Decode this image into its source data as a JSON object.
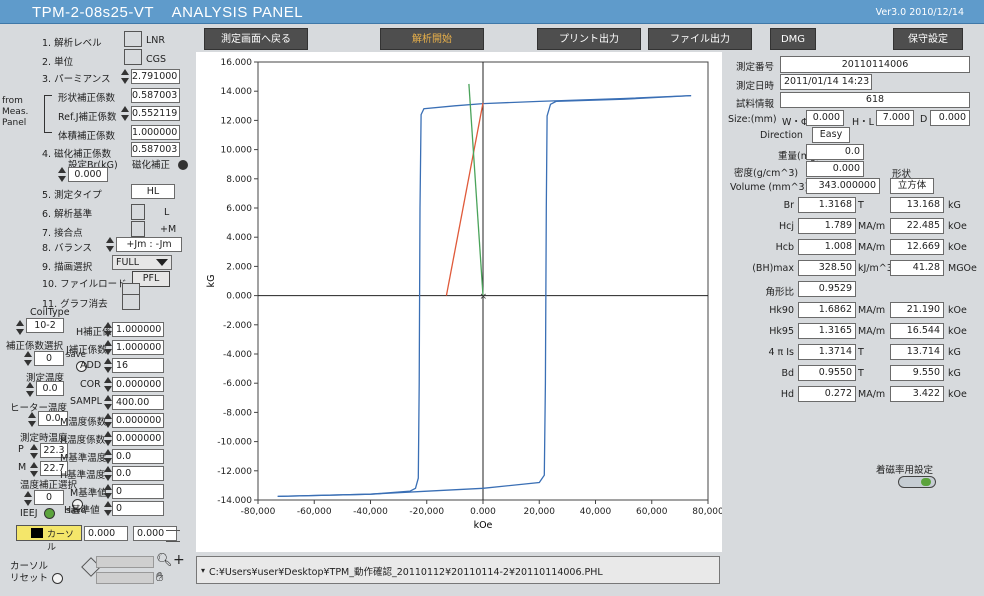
{
  "window": {
    "title": "TPM-2-08s25-VT    ANALYSIS PANEL",
    "version": "Ver3.0 2010/12/14"
  },
  "toolbar": {
    "back": "測定画面へ戻る",
    "analyze": "解析開始",
    "print": "プリント出力",
    "file": "ファイル出力",
    "dmg": "DMG",
    "maint": "保守設定"
  },
  "left": {
    "r1": "1. 解析レベル",
    "r1_opt": "LNR",
    "r2": "2. 単位",
    "r2_opt": "CGS",
    "r3": "3. パーミアンス",
    "r3_val": "2.791000",
    "shape": "形状補正係数",
    "shape_val": "0.587003",
    "refj": "Ref.J補正係数",
    "refj_val": "0.552119",
    "vol": "体積補正係数",
    "vol_val": "1.000000",
    "from": "from Meas. Panel",
    "r4": "4. 磁化補正係数",
    "r4_val": "0.587003",
    "br_set": "設定Br(kG)",
    "br_set_val": "0.000",
    "mag_corr": "磁化補正",
    "r5": "5. 測定タイプ",
    "r5_val": "HL",
    "r6": "6. 解析基準",
    "r6_val": "L",
    "r7": "7. 接合点",
    "r7_val": "+M",
    "r8": "8. バランス",
    "r8_val": "+Jm : -Jm",
    "r9": "9. 描画選択",
    "r9_val": "FULL",
    "r10": "10. ファイルロード",
    "r10_val": "PFL",
    "r11": "11. グラフ消去",
    "coil": "CoilType",
    "coil_val": "10-2",
    "corr_sel": "補正係数選択",
    "corr_sel_val": "0",
    "save": "save",
    "temp": "測定温度",
    "temp_val": "0.0",
    "heater": "ヒーター温度",
    "heater_val": "0.0",
    "meas_temp": "測定時温度",
    "p_lbl": "P",
    "p_val": "22.3",
    "m_lbl": "M",
    "m_val": "22.7",
    "temp_sel": "温度補正選択",
    "temp_sel_val": "0",
    "ieej": "IEEJ",
    "h_corr": "H補正係数",
    "h_corr_val": "1.000000",
    "j_corr": "J補正係数",
    "j_corr_val": "1.000000",
    "add": "ADD",
    "add_val": "16",
    "cor": "COR",
    "cor_val": "0.000000",
    "sampl": "SAMPL",
    "sampl_val": "400.00",
    "m_temp_coef": "M温度係数",
    "m_temp_coef_val": "0.000000",
    "h_temp_coef": "H温度係数",
    "h_temp_coef_val": "0.000000",
    "m_ref_temp": "M基準温度",
    "m_ref_temp_val": "0.0",
    "h_ref_temp": "H基準温度",
    "h_ref_temp_val": "0.0",
    "m_ref_val": "M基準値",
    "m_ref_val_val": "0",
    "h_ref_val": "H基準値",
    "h_ref_val_val": "0",
    "cursor_lbl": "カーソル",
    "cursor_x": "0.000",
    "cursor_y": "0.000",
    "cursor_reset": "カーソル リセット"
  },
  "path": "C:¥Users¥user¥Desktop¥TPM_動作確認_20110112¥20110114-2¥20110114006.PHL",
  "right": {
    "meas_no": "測定番号",
    "meas_no_val": "20110114006",
    "meas_dt": "測定日時",
    "meas_dt_val": "2011/01/14 14:23",
    "sample": "試料情報",
    "sample_val": "618",
    "size": "Size:(mm)",
    "w": "W・Φ",
    "w_val": "0.000",
    "h": "H・L",
    "h_val": "7.000",
    "d": "D",
    "d_val": "0.000",
    "direction": "Direction",
    "direction_val": "Easy",
    "weight": "重量(mg)",
    "weight_val": "0.0",
    "density": "密度(g/cm^3)",
    "density_val": "0.000",
    "shape": "形状",
    "volume": "Volume (mm^3)",
    "volume_val": "343.000000",
    "shape_val": "立方体",
    "rows": [
      {
        "name": "Br",
        "si": "1.3168",
        "siu": "T",
        "cgs": "13.168",
        "cgsu": "kG"
      },
      {
        "name": "Hcj",
        "si": "1.789",
        "siu": "MA/m",
        "cgs": "22.485",
        "cgsu": "kOe"
      },
      {
        "name": "Hcb",
        "si": "1.008",
        "siu": "MA/m",
        "cgs": "12.669",
        "cgsu": "kOe"
      },
      {
        "name": "(BH)max",
        "si": "328.50",
        "siu": "kJ/m^3",
        "cgs": "41.28",
        "cgsu": "MGOe"
      },
      {
        "name": "角形比",
        "si": "0.9529",
        "siu": "",
        "cgs": "",
        "cgsu": ""
      },
      {
        "name": "Hk90",
        "si": "1.6862",
        "siu": "MA/m",
        "cgs": "21.190",
        "cgsu": "kOe"
      },
      {
        "name": "Hk95",
        "si": "1.3165",
        "siu": "MA/m",
        "cgs": "16.544",
        "cgsu": "kOe"
      },
      {
        "name": "4 π Is",
        "si": "1.3714",
        "siu": "T",
        "cgs": "13.714",
        "cgsu": "kG"
      },
      {
        "name": "Bd",
        "si": "0.9550",
        "siu": "T",
        "cgs": "9.550",
        "cgsu": "kG"
      },
      {
        "name": "Hd",
        "si": "0.272",
        "siu": "MA/m",
        "cgs": "3.422",
        "cgsu": "kOe"
      }
    ],
    "mag_setting": "着磁率用設定"
  },
  "colors": {
    "title_bar": "#5f9bcb",
    "button_dark": "#4e4e4e",
    "analyze_text": "#e8b04a",
    "loop": "#3a6fb5",
    "red_line": "#e05a3a",
    "green_line": "#4aa35a",
    "radio_on": "#5ba33c"
  },
  "chart_data": {
    "type": "line",
    "xlabel": "kOe",
    "ylabel": "kG",
    "xlim": [
      -80000,
      80000
    ],
    "ylim": [
      -14,
      16
    ],
    "xticks": [
      "-80,000",
      "-60,000",
      "-40,000",
      "-20,000",
      "0.000",
      "20,000",
      "40,000",
      "60,000",
      "80,000"
    ],
    "yticks": [
      "16.000",
      "14.000",
      "12.000",
      "10.000",
      "8.000",
      "6.000",
      "4.000",
      "2.000",
      "0.000",
      "-2.000",
      "-4.000",
      "-6.000",
      "-8.000",
      "-10.000",
      "-12.000",
      "-14.000"
    ],
    "series": [
      {
        "color": "#3a6fb5",
        "points": [
          [
            -73000,
            -13.75
          ],
          [
            -40000,
            -13.6
          ],
          [
            -26000,
            -13.4
          ],
          [
            -24000,
            -13.2
          ],
          [
            -23000,
            -12.5
          ],
          [
            -22700,
            -6
          ],
          [
            -22400,
            6
          ],
          [
            -22000,
            12.4
          ],
          [
            -21000,
            12.8
          ],
          [
            -10000,
            13.0
          ],
          [
            0,
            13.15
          ],
          [
            20000,
            13.3
          ],
          [
            50000,
            13.5
          ],
          [
            74000,
            13.7
          ]
        ]
      },
      {
        "color": "#3a6fb5",
        "points": [
          [
            74000,
            13.7
          ],
          [
            50000,
            13.45
          ],
          [
            26000,
            13.3
          ],
          [
            24000,
            13.1
          ],
          [
            22800,
            12.3
          ],
          [
            22500,
            6
          ],
          [
            22200,
            -6
          ],
          [
            21800,
            -12.3
          ],
          [
            20000,
            -12.8
          ],
          [
            0,
            -13.2
          ],
          [
            -20000,
            -13.4
          ],
          [
            -40000,
            -13.6
          ],
          [
            -73000,
            -13.75
          ]
        ]
      },
      {
        "color": "#e05a3a",
        "points": [
          [
            -13000,
            0
          ],
          [
            0,
            13.2
          ]
        ]
      },
      {
        "color": "#4aa35a",
        "points": [
          [
            -5000,
            14.5
          ],
          [
            0,
            0
          ]
        ]
      }
    ],
    "cursor": [
      0,
      0
    ]
  }
}
